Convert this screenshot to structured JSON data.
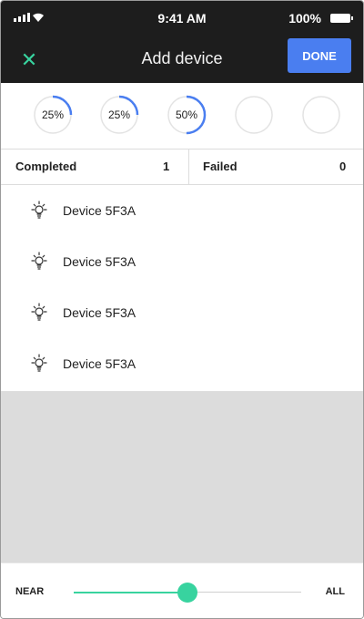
{
  "status_bar": {
    "time": "9:41 AM",
    "battery": "100%"
  },
  "nav": {
    "title": "Add device",
    "done_label": "DONE",
    "close_icon": "close-icon"
  },
  "progress": [
    {
      "label": "25%",
      "fraction": 0.25
    },
    {
      "label": "25%",
      "fraction": 0.25
    },
    {
      "label": "50%",
      "fraction": 0.5
    },
    {
      "label": "",
      "fraction": 0
    },
    {
      "label": "",
      "fraction": 0
    }
  ],
  "summary": {
    "completed_label": "Completed",
    "completed_count": "1",
    "failed_label": "Failed",
    "failed_count": "0"
  },
  "devices": [
    {
      "name": "Device  5F3A",
      "icon": "lightbulb-icon"
    },
    {
      "name": "Device  5F3A",
      "icon": "lightbulb-icon"
    },
    {
      "name": "Device  5F3A",
      "icon": "lightbulb-icon"
    },
    {
      "name": "Device  5F3A",
      "icon": "lightbulb-icon"
    }
  ],
  "range": {
    "near_label": "NEAR",
    "all_label": "ALL",
    "value_fraction": 0.5
  },
  "colors": {
    "accent": "#38d39f",
    "primary": "#4a7ef0",
    "header_bg": "#1d1d1d",
    "empty_bg": "#dcdcdc"
  }
}
